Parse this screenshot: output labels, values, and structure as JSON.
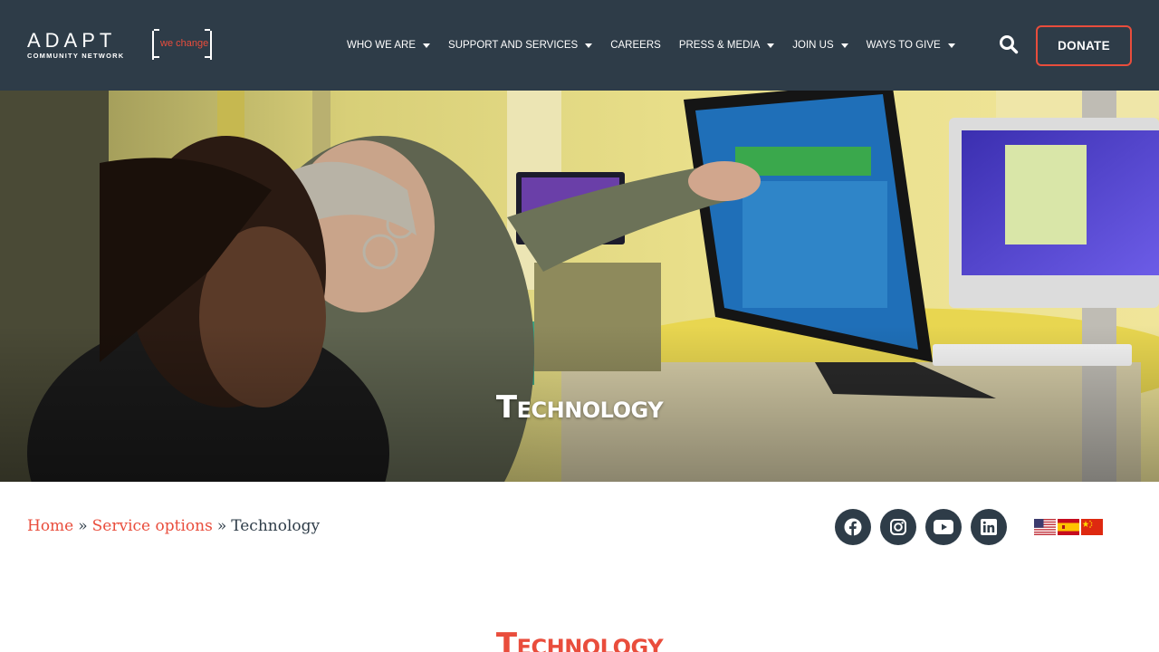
{
  "brand": {
    "name": "ADAPT",
    "subtitle": "COMMUNITY NETWORK",
    "tagline": "we change"
  },
  "nav": {
    "items": [
      {
        "label": "WHO WE ARE",
        "has_dropdown": true
      },
      {
        "label": "SUPPORT AND SERVICES",
        "has_dropdown": true
      },
      {
        "label": "CAREERS",
        "has_dropdown": false
      },
      {
        "label": "PRESS & MEDIA",
        "has_dropdown": true
      },
      {
        "label": "JOIN US",
        "has_dropdown": true
      },
      {
        "label": "WAYS TO GIVE",
        "has_dropdown": true
      }
    ],
    "search_icon": "search-icon",
    "donate_label": "DONATE"
  },
  "hero": {
    "title": "Technology"
  },
  "breadcrumb": {
    "home": "Home",
    "separator": "»",
    "parent": "Service options",
    "current": "Technology"
  },
  "social": [
    {
      "name": "facebook-icon"
    },
    {
      "name": "instagram-icon"
    },
    {
      "name": "youtube-icon"
    },
    {
      "name": "linkedin-icon"
    }
  ],
  "languages": [
    {
      "name": "flag-us-icon"
    },
    {
      "name": "flag-es-icon"
    },
    {
      "name": "flag-cn-icon"
    }
  ],
  "main": {
    "heading": "Technology"
  },
  "colors": {
    "header_bg": "#2e3c48",
    "accent": "#e94d3c",
    "text_dark": "#2e3c48"
  }
}
